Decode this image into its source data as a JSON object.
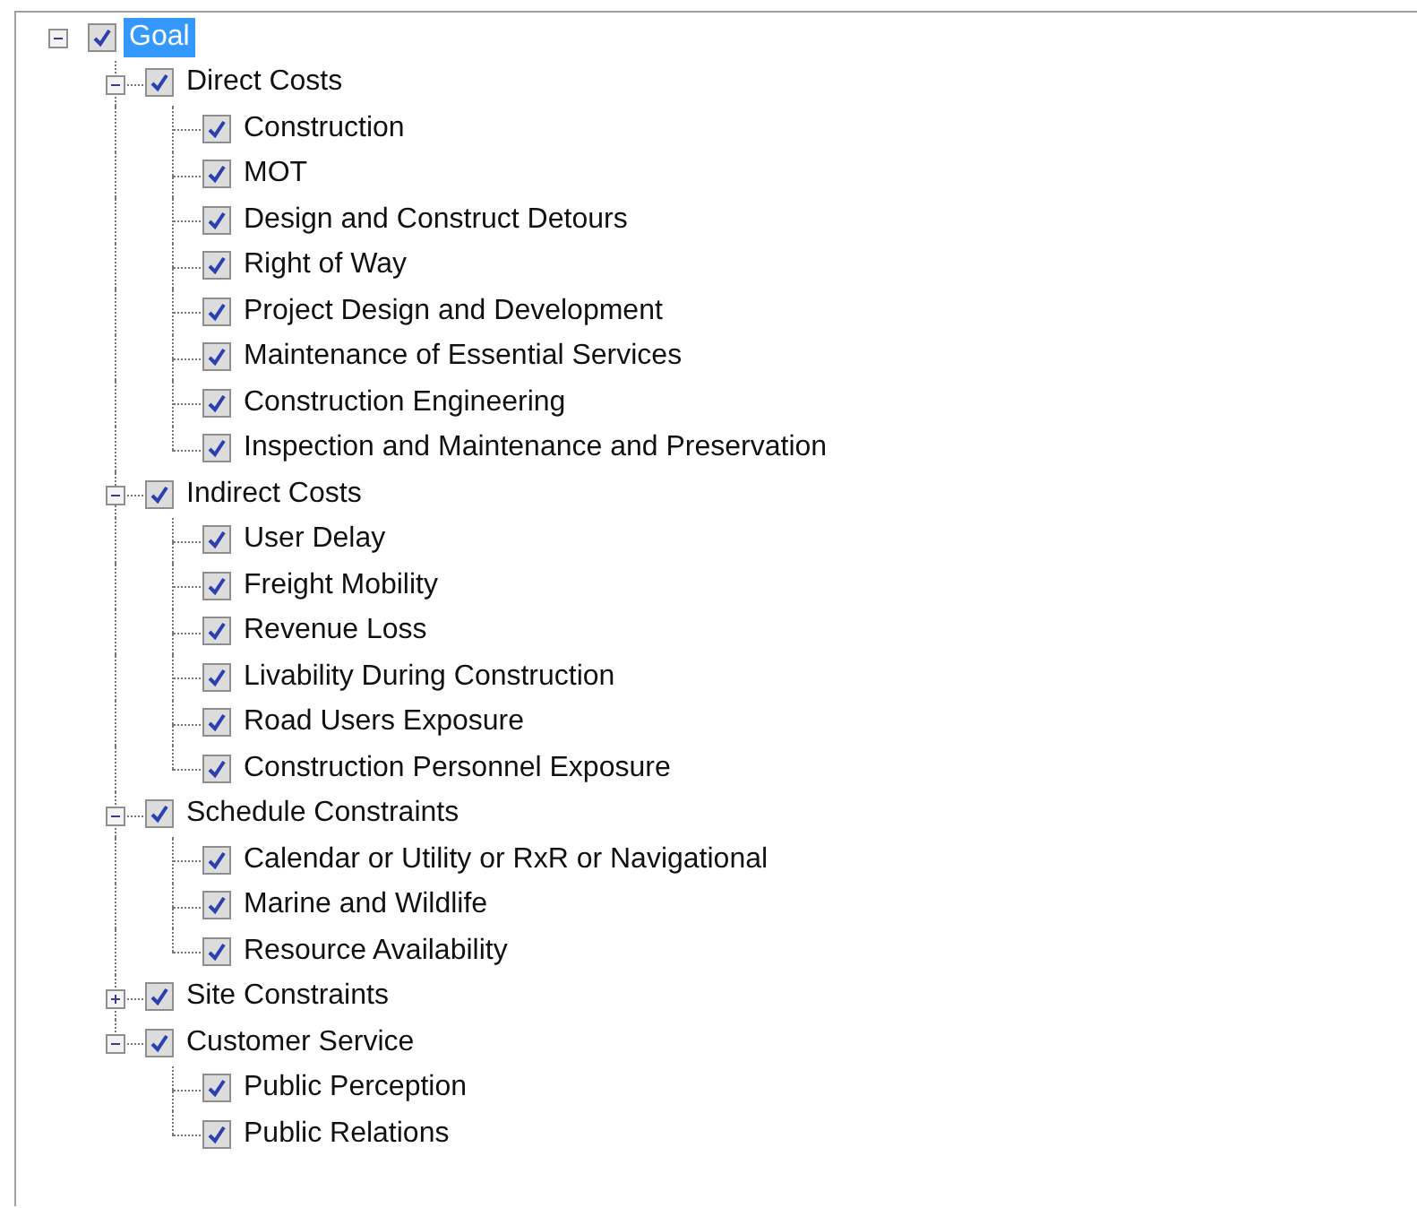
{
  "tree": [
    {
      "label": "Goal",
      "checked": true,
      "selected": true,
      "expanded": true,
      "children": [
        {
          "label": "Direct Costs",
          "checked": true,
          "selected": false,
          "expanded": true,
          "children": [
            {
              "label": "Construction",
              "checked": true,
              "selected": false
            },
            {
              "label": "MOT",
              "checked": true,
              "selected": false
            },
            {
              "label": "Design and Construct Detours",
              "checked": true,
              "selected": false
            },
            {
              "label": "Right of Way",
              "checked": true,
              "selected": false
            },
            {
              "label": "Project Design and Development",
              "checked": true,
              "selected": false
            },
            {
              "label": "Maintenance of Essential Services",
              "checked": true,
              "selected": false
            },
            {
              "label": "Construction Engineering",
              "checked": true,
              "selected": false
            },
            {
              "label": "Inspection and Maintenance and Preservation",
              "checked": true,
              "selected": false
            }
          ]
        },
        {
          "label": "Indirect Costs",
          "checked": true,
          "selected": false,
          "expanded": true,
          "children": [
            {
              "label": "User Delay",
              "checked": true,
              "selected": false
            },
            {
              "label": "Freight Mobility",
              "checked": true,
              "selected": false
            },
            {
              "label": "Revenue Loss",
              "checked": true,
              "selected": false
            },
            {
              "label": "Livability During Construction",
              "checked": true,
              "selected": false
            },
            {
              "label": "Road Users Exposure",
              "checked": true,
              "selected": false
            },
            {
              "label": "Construction Personnel Exposure",
              "checked": true,
              "selected": false
            }
          ]
        },
        {
          "label": "Schedule Constraints",
          "checked": true,
          "selected": false,
          "expanded": true,
          "children": [
            {
              "label": "Calendar or Utility or RxR or Navigational",
              "checked": true,
              "selected": false
            },
            {
              "label": "Marine and Wildlife",
              "checked": true,
              "selected": false
            },
            {
              "label": "Resource Availability",
              "checked": true,
              "selected": false
            }
          ]
        },
        {
          "label": "Site Constraints",
          "checked": true,
          "selected": false,
          "expanded": false
        },
        {
          "label": "Customer Service",
          "checked": true,
          "selected": false,
          "expanded": true,
          "children": [
            {
              "label": "Public Perception",
              "checked": true,
              "selected": false
            },
            {
              "label": "Public Relations",
              "checked": true,
              "selected": false
            }
          ]
        }
      ]
    }
  ]
}
